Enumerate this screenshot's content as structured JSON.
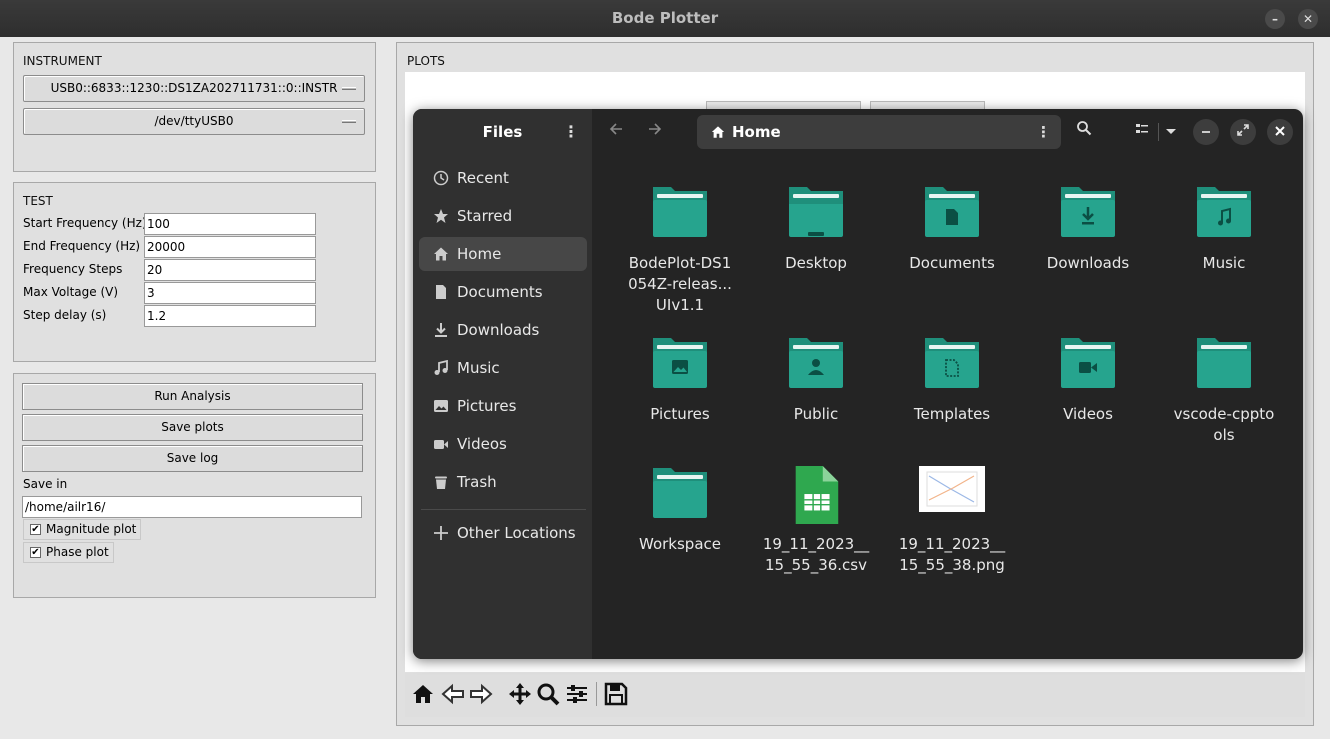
{
  "window": {
    "title": "Bode Plotter"
  },
  "instrument": {
    "label": "INSTRUMENT",
    "visa": "USB0::6833::1230::DS1ZA202711731::0::INSTR",
    "serial": "/dev/ttyUSB0"
  },
  "test": {
    "label": "TEST",
    "fields": [
      {
        "label": "Start Frequency (Hz)",
        "value": "100"
      },
      {
        "label": "End Frequency (Hz)",
        "value": "20000"
      },
      {
        "label": "Frequency Steps",
        "value": "20"
      },
      {
        "label": "Max Voltage (V)",
        "value": "3"
      },
      {
        "label": "Step delay (s)",
        "value": "1.2"
      }
    ]
  },
  "actions": {
    "run": "Run Analysis",
    "save_plots": "Save plots",
    "save_log": "Save log",
    "save_in_label": "Save in",
    "save_in_value": "/home/ailr16/",
    "magnitude": "Magnitude plot",
    "phase": "Phase plot",
    "magnitude_checked": true,
    "phase_checked": true
  },
  "plots": {
    "label": "PLOTS"
  },
  "files": {
    "title": "Files",
    "location": "Home",
    "sidebar": [
      {
        "label": "Recent",
        "icon": "clock-icon"
      },
      {
        "label": "Starred",
        "icon": "star-icon"
      },
      {
        "label": "Home",
        "icon": "home-icon",
        "selected": true
      },
      {
        "label": "Documents",
        "icon": "document-icon"
      },
      {
        "label": "Downloads",
        "icon": "download-icon"
      },
      {
        "label": "Music",
        "icon": "music-icon"
      },
      {
        "label": "Pictures",
        "icon": "image-icon"
      },
      {
        "label": "Videos",
        "icon": "video-icon"
      },
      {
        "label": "Trash",
        "icon": "trash-icon"
      }
    ],
    "other_locations": "Other Locations",
    "items": [
      {
        "name": "BodePlot-DS1054Z-releas... UIv1.1",
        "type": "folder",
        "icon": "folder-icon"
      },
      {
        "name": "Desktop",
        "type": "folder",
        "icon": "desktop-folder-icon"
      },
      {
        "name": "Documents",
        "type": "folder",
        "icon": "documents-folder-icon"
      },
      {
        "name": "Downloads",
        "type": "folder",
        "icon": "downloads-folder-icon"
      },
      {
        "name": "Music",
        "type": "folder",
        "icon": "music-folder-icon"
      },
      {
        "name": "Pictures",
        "type": "folder",
        "icon": "pictures-folder-icon"
      },
      {
        "name": "Public",
        "type": "folder",
        "icon": "public-folder-icon"
      },
      {
        "name": "Templates",
        "type": "folder",
        "icon": "templates-folder-icon"
      },
      {
        "name": "Videos",
        "type": "folder",
        "icon": "videos-folder-icon"
      },
      {
        "name": "vscode-cpptools",
        "type": "folder",
        "icon": "folder-icon"
      },
      {
        "name": "Workspace",
        "type": "folder",
        "icon": "folder-icon"
      },
      {
        "name": "19_11_2023__15_55_36.csv",
        "type": "csv",
        "icon": "spreadsheet-icon"
      },
      {
        "name": "19_11_2023__15_55_38.png",
        "type": "png",
        "icon": "image-thumbnail"
      }
    ]
  }
}
